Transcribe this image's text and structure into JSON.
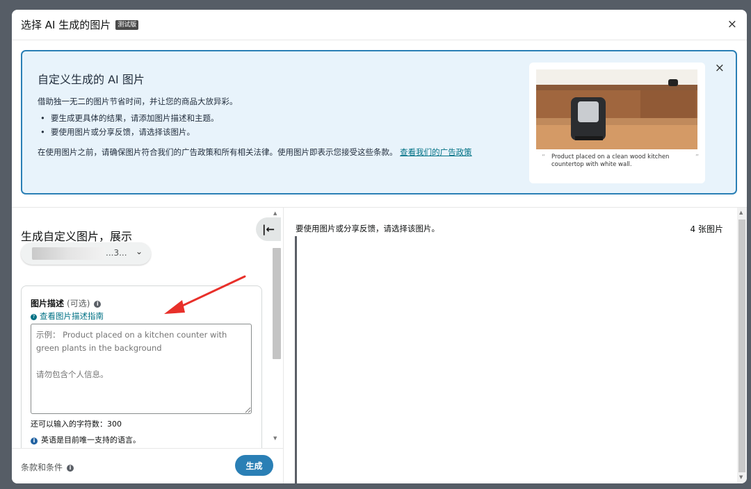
{
  "modal": {
    "title": "选择 AI 生成的图片",
    "beta": "测试版",
    "close": "×"
  },
  "banner": {
    "title": "自定义生成的 AI 图片",
    "description": "借助独一无二的图片节省时间，并让您的商品大放异彩。",
    "bullets": [
      "要生成更具体的结果，请添加图片描述和主题。",
      "要使用图片或分享反馈，请选择该图片。"
    ],
    "policy_text": "在使用图片之前，请确保图片符合我们的广告政策和所有相关法律。使用图片即表示您接受这些条款。",
    "policy_link": "查看我们的广告政策",
    "close": "×",
    "example_caption": "Product placed on a clean wood kitchen countertop with white wall."
  },
  "left": {
    "heading": "生成自定义图片，展示",
    "asin_suffix": "...3...",
    "collapse_icon": "|←",
    "description_label": "图片描述",
    "description_optional": "(可选)",
    "guide_link": "查看图片描述指南",
    "placeholder": "示例： Product placed on a kitchen counter with green plants in the background\n\n请勿包含个人信息。",
    "char_count": "还可以输入的字符数：300",
    "language_note": "英语是目前唯一支持的语言。",
    "terms": "条款和条件",
    "generate": "生成"
  },
  "right": {
    "note": "要使用图片或分享反馈，请选择该图片。",
    "count": "4 张图片"
  },
  "colors": {
    "accent": "#2a7fb5",
    "link": "#007185",
    "banner_bg": "#e8f3fb",
    "annotation": "#e8302a"
  }
}
